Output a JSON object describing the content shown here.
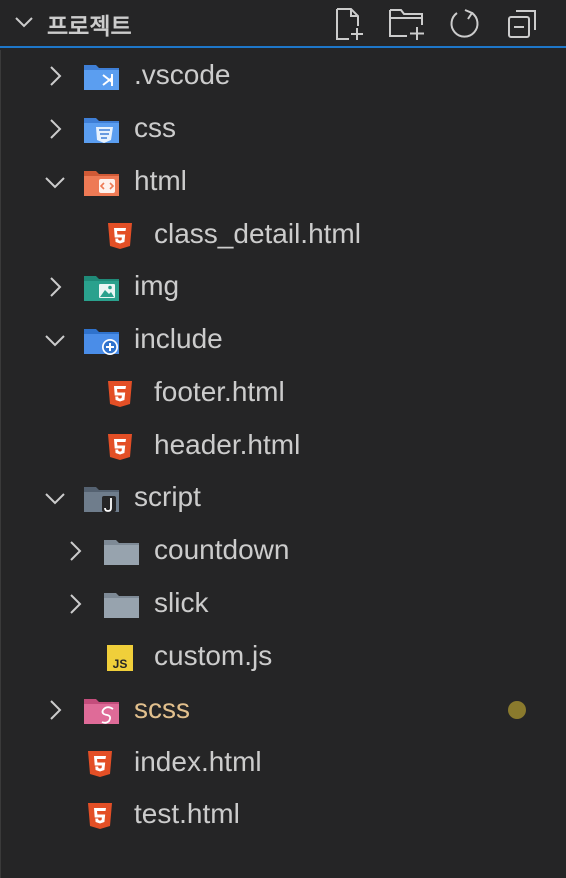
{
  "explorer": {
    "title": "프로젝트",
    "actions": [
      {
        "name": "new-file",
        "icon": "new-file-icon"
      },
      {
        "name": "new-folder",
        "icon": "new-folder-icon"
      },
      {
        "name": "refresh",
        "icon": "refresh-icon"
      },
      {
        "name": "collapse-all",
        "icon": "collapse-all-icon"
      }
    ]
  },
  "tree": [
    {
      "label": ".vscode",
      "type": "folder",
      "expanded": false,
      "icon": "vscode-folder-icon"
    },
    {
      "label": "css",
      "type": "folder",
      "expanded": false,
      "icon": "css-folder-icon"
    },
    {
      "label": "html",
      "type": "folder",
      "expanded": true,
      "icon": "html-folder-icon"
    },
    {
      "label": "class_detail.html",
      "type": "file",
      "icon": "html5-icon"
    },
    {
      "label": "img",
      "type": "folder",
      "expanded": false,
      "icon": "images-folder-icon"
    },
    {
      "label": "include",
      "type": "folder",
      "expanded": true,
      "icon": "include-folder-icon"
    },
    {
      "label": "footer.html",
      "type": "file",
      "icon": "html5-icon"
    },
    {
      "label": "header.html",
      "type": "file",
      "icon": "html5-icon"
    },
    {
      "label": "script",
      "type": "folder",
      "expanded": true,
      "icon": "script-folder-icon"
    },
    {
      "label": "countdown",
      "type": "folder",
      "expanded": false,
      "icon": "folder-icon"
    },
    {
      "label": "slick",
      "type": "folder",
      "expanded": false,
      "icon": "folder-icon"
    },
    {
      "label": "custom.js",
      "type": "file",
      "icon": "js-icon"
    },
    {
      "label": "scss",
      "type": "folder",
      "expanded": false,
      "icon": "sass-folder-icon",
      "modified": true
    },
    {
      "label": "index.html",
      "type": "file",
      "icon": "html5-icon"
    },
    {
      "label": "test.html",
      "type": "file",
      "icon": "html5-icon"
    }
  ],
  "colors": {
    "background": "#252526",
    "text": "#cccccc",
    "modified_text": "#e2c08d",
    "modified_dot": "#8a7a2d",
    "focus_border": "#1e77c9"
  }
}
